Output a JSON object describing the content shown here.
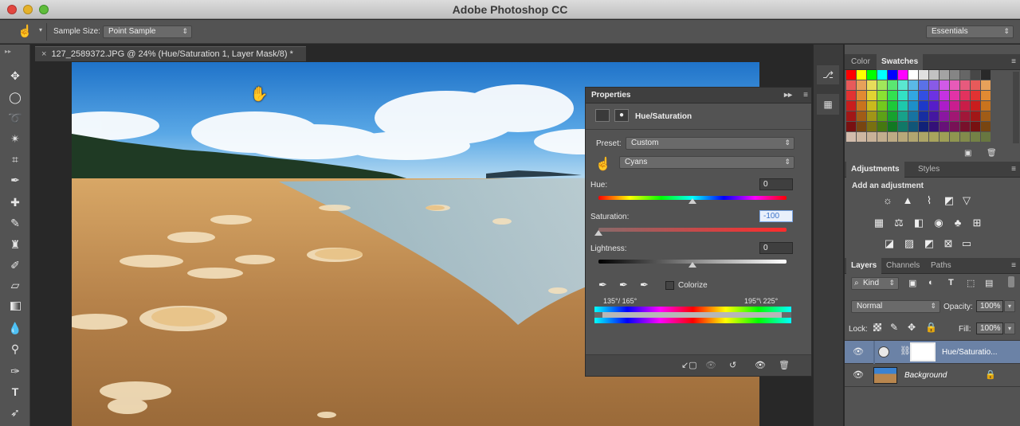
{
  "app": {
    "title": "Adobe Photoshop CC"
  },
  "options_bar": {
    "sample_size_label": "Sample Size:",
    "sample_size_value": "Point Sample",
    "workspace_value": "Essentials"
  },
  "document": {
    "tab_label": "127_2589372.JPG @ 24% (Hue/Saturation 1, Layer Mask/8) *",
    "close_glyph": "×"
  },
  "properties": {
    "panel_title": "Properties",
    "adjustment_name": "Hue/Saturation",
    "preset_label": "Preset:",
    "preset_value": "Custom",
    "channel_value": "Cyans",
    "hue_label": "Hue:",
    "hue_value": "0",
    "saturation_label": "Saturation:",
    "saturation_value": "-100",
    "lightness_label": "Lightness:",
    "lightness_value": "0",
    "colorize_label": "Colorize",
    "range_left": "135°/ 165°",
    "range_right": "195°\\ 225°"
  },
  "color_panel": {
    "tabs": [
      "Color",
      "Swatches"
    ],
    "active_tab": "Swatches"
  },
  "adjustments_panel": {
    "tabs": [
      "Adjustments",
      "Styles"
    ],
    "add_label": "Add an adjustment"
  },
  "layers_panel": {
    "tabs": [
      "Layers",
      "Channels",
      "Paths"
    ],
    "kind_value": "Kind",
    "blend_mode": "Normal",
    "opacity_label": "Opacity:",
    "opacity_value": "100%",
    "lock_label": "Lock:",
    "fill_label": "Fill:",
    "fill_value": "100%",
    "layers": [
      {
        "name": "Hue/Saturatio..."
      },
      {
        "name": "Background"
      }
    ]
  }
}
